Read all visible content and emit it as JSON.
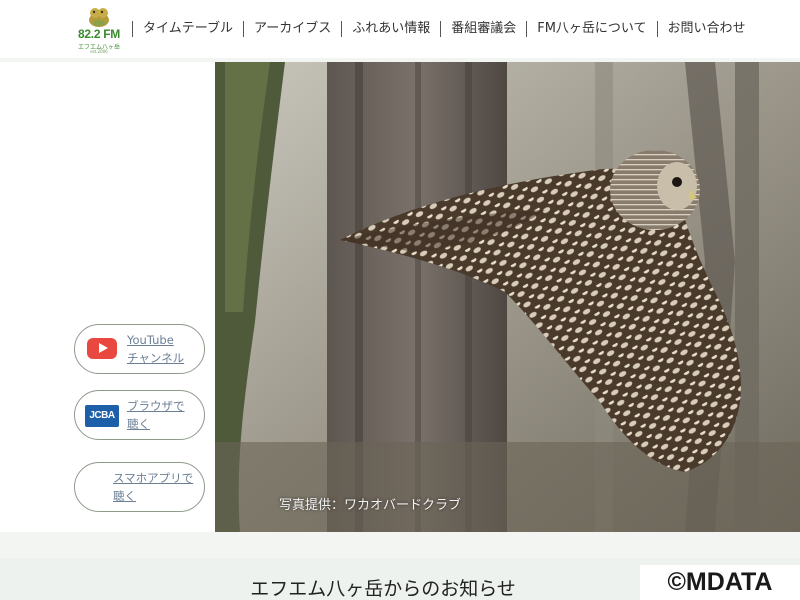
{
  "header": {
    "logo": {
      "frequency": "82.2",
      "band": "FM",
      "station_kana": "エフエム八ヶ岳",
      "established": "est.2006"
    },
    "nav": [
      {
        "label": "タイムテーブル"
      },
      {
        "label": "アーカイブス"
      },
      {
        "label": "ふれあい情報"
      },
      {
        "label": "番組審議会"
      },
      {
        "label": "FM八ヶ岳について"
      },
      {
        "label": "お問い合わせ"
      }
    ]
  },
  "sidebar": {
    "youtube": {
      "line1": "YouTube",
      "line2": "チャンネル",
      "icon": "youtube-play-icon"
    },
    "browser": {
      "line1": "ブラウザで",
      "line2": "聴く",
      "icon": "jcba-logo",
      "logo_text": "JCBA"
    },
    "app": {
      "line1": "スマホアプリで",
      "line2": "聴く"
    }
  },
  "hero": {
    "photo_credit": "写真提供：ワカオバードクラブ",
    "subject": "owl in flight"
  },
  "notice": {
    "title": "エフエム八ヶ岳からのお知らせ"
  },
  "watermark": "©MDATA",
  "colors": {
    "brand_green": "#3a8a2e",
    "youtube_red": "#e8483f",
    "jcba_blue": "#1d5fa8",
    "link_blue": "#6b7f95",
    "button_border": "#8f9a8c"
  }
}
